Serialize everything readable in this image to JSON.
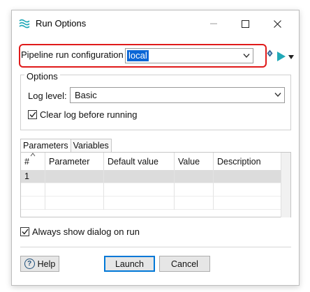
{
  "window": {
    "title": "Run Options",
    "controls": {
      "minimize": "—",
      "maximize": "☐",
      "close": "✕"
    }
  },
  "run_config": {
    "label": "Pipeline run configuration",
    "value": "local",
    "value_selected": true,
    "run_icon_color": "#22a9b8",
    "diamond_icon_color": "#2b5c8a",
    "highlight_color": "#e01a1a"
  },
  "options": {
    "legend": "Options",
    "log_level_label": "Log level:",
    "log_level_value": "Basic",
    "clear_log_label": "Clear log before running",
    "clear_log_checked": true
  },
  "tabs": [
    {
      "label": "Parameters",
      "active": true
    },
    {
      "label": "Variables",
      "active": false
    }
  ],
  "grid": {
    "columns": [
      "#",
      "Parameter",
      "Default value",
      "Value",
      "Description"
    ],
    "rows": [
      [
        "1",
        "",
        "",
        "",
        ""
      ],
      [
        "",
        "",
        "",
        "",
        ""
      ],
      [
        "",
        "",
        "",
        "",
        ""
      ]
    ]
  },
  "always_show": {
    "label": "Always show dialog on run",
    "checked": true
  },
  "buttons": {
    "help": "Help",
    "launch": "Launch",
    "cancel": "Cancel"
  }
}
